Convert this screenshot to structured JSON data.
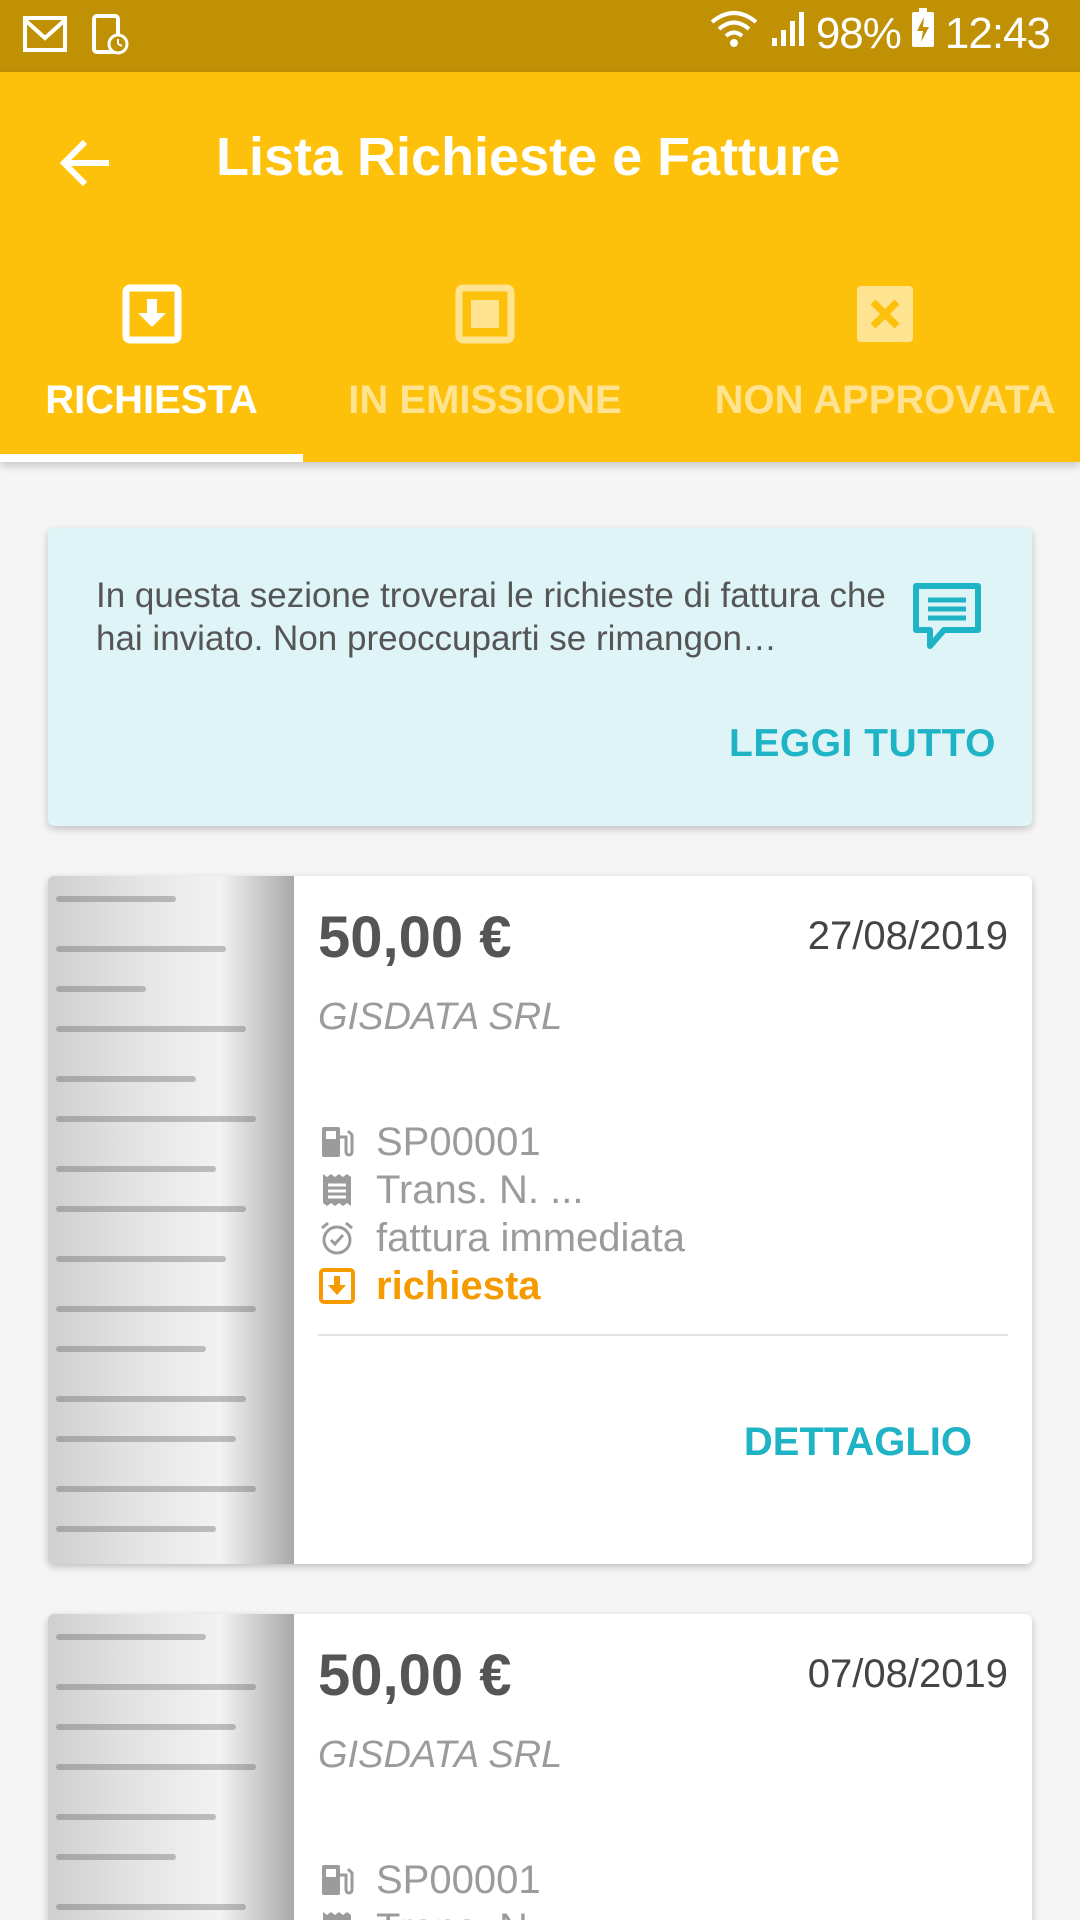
{
  "status_bar": {
    "battery": "98%",
    "time": "12:43"
  },
  "app_bar": {
    "title": "Lista Richieste e Fatture"
  },
  "tabs": [
    {
      "label": "RICHIESTA",
      "icon": "download-box-icon",
      "active": true
    },
    {
      "label": "IN EMISSIONE",
      "icon": "square-icon",
      "active": false
    },
    {
      "label": "NON APPROVATA",
      "icon": "close-box-icon",
      "active": false
    }
  ],
  "info_card": {
    "text": "In questa sezione troverai le richieste di fattura che hai inviato. Non preoccuparti se rimangon…",
    "action": "LEGGI TUTTO"
  },
  "invoices": [
    {
      "amount": "50,00 €",
      "date": "27/08/2019",
      "company": "GISDATA SRL",
      "station": "SP00001",
      "transaction": "Trans. N. ...",
      "invoice_type": "fattura immediata",
      "status": "richiesta",
      "action": "DETTAGLIO"
    },
    {
      "amount": "50,00 €",
      "date": "07/08/2019",
      "company": "GISDATA SRL",
      "station": "SP00001",
      "transaction": "Trans. N. ..."
    }
  ],
  "colors": {
    "primary": "#fec10b",
    "status_bar": "#c09105",
    "accent": "#1fb3c6",
    "status_orange": "#f59b00",
    "info_bg": "#dff4f7"
  }
}
